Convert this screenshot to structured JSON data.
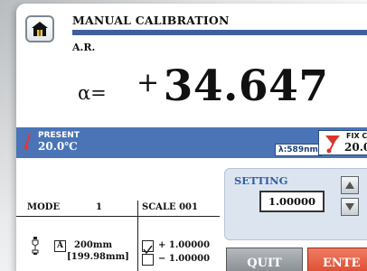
{
  "header": {
    "title": "MANUAL CALIBRATION",
    "subtitle": "A.R."
  },
  "reading": {
    "label": "α=",
    "sign": "+",
    "value": "34.647"
  },
  "info_bar": {
    "present_label": "PRESENT",
    "present_temp": "20.0℃",
    "wavelength": "λ:589nm",
    "fix_label": "FIX C",
    "fix_temp": "20.0°"
  },
  "setting": {
    "label": "SETTING",
    "value": "1.00000"
  },
  "mode_table": {
    "mode_header": "MODE",
    "mode_value": "1",
    "scale_header": "SCALE 001",
    "size_letter": "A",
    "size_value": "200mm",
    "size_sub": "[199.98mm]",
    "scale_rows": [
      {
        "checked": true,
        "text": "+ 1.00000"
      },
      {
        "checked": false,
        "text": "− 1.00000"
      }
    ]
  },
  "buttons": {
    "quit": "QUIT",
    "enter": "ENTE"
  },
  "colors": {
    "accent": "#4a74b6",
    "title_rule": "#3f5f9f",
    "enter": "#e3553a",
    "setting_text": "#2f5fa8"
  },
  "icons": [
    "home-icon",
    "thermometer-icon",
    "arrow-up-icon",
    "arrow-down-icon",
    "sensor-icon",
    "check-icon"
  ]
}
